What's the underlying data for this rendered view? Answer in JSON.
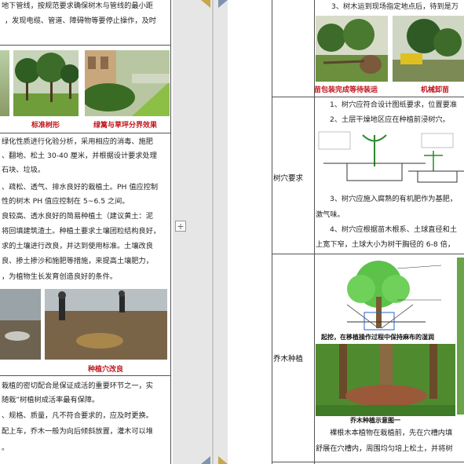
{
  "left_page": {
    "lines_top": [
      "地下管线，按规范要求确保树木与管线的最小距",
      "，发现电缆、管道、障碍物等要停止操作，及时"
    ],
    "captions_top": [
      "标准树形",
      "绿篱与草坪分界效果"
    ],
    "lines_mid": [
      "绿化性质进行化验分析，采用相应的消毒、施肥",
      "、翻地、松土 30-40 厘米，并根据设计要求处理",
      "石块、垃圾。",
      "、疏松、透气、排水良好的栽植土。PH 值应控制",
      "性的树木 PH 值应控制在 5~6.5 之间。",
      "良较高、透水良好的简易种植土（建议黄土：泥",
      "将回填建筑渣土。种植土要求土壤团粒结构良好，",
      "求的土壤进行改良，并达到使用标准。土壤改良",
      "良、掺土掺沙和施肥等措施，来提高土壤肥力，",
      "，为植物生长发育创造良好的条件。"
    ],
    "caption_mid": "种植穴改良",
    "lines_bottom": [
      "栽植的密切配合是保证成活的重要环节之一，实",
      "随栽”树植树成活率最有保障。",
      "、规格、质量，凡不符合要求的，应及时更换。",
      "配上车，乔木一般为向后倾斜放置，灌木可以堆",
      "。"
    ]
  },
  "right_page": {
    "row1": {
      "text": "3、树木运到现场指定地点后，待到是万",
      "captions": [
        "苗包装完成等待装运",
        "机械卸苗"
      ]
    },
    "row2": {
      "label": "树穴要求",
      "lines": [
        "1、树穴应符合设计图纸要求，位置要准",
        "2、土层干燥地区应在种植前浸树穴。",
        "3、树穴应施入腐熟的有机肥作为基肥，",
        "激气味。",
        "4、树穴应根据苗木根系、土球直径和土",
        "上宽下窄，土球大小为树干胸径的 6-8 倍，"
      ]
    },
    "row3": {
      "label": "乔木种植",
      "diagram_caption": "起挖，在移植操作过程中保持麻布的湿润",
      "photo_caption": "乔木种植示意图一",
      "lines": [
        "裸根木本植物在栽植前，先在穴槽内填",
        "舒展在穴槽内，周围均匀培上松土，并将树"
      ]
    }
  },
  "add_button": "+",
  "colors": {
    "caption_red": "#c0141a",
    "border": "#555555"
  }
}
